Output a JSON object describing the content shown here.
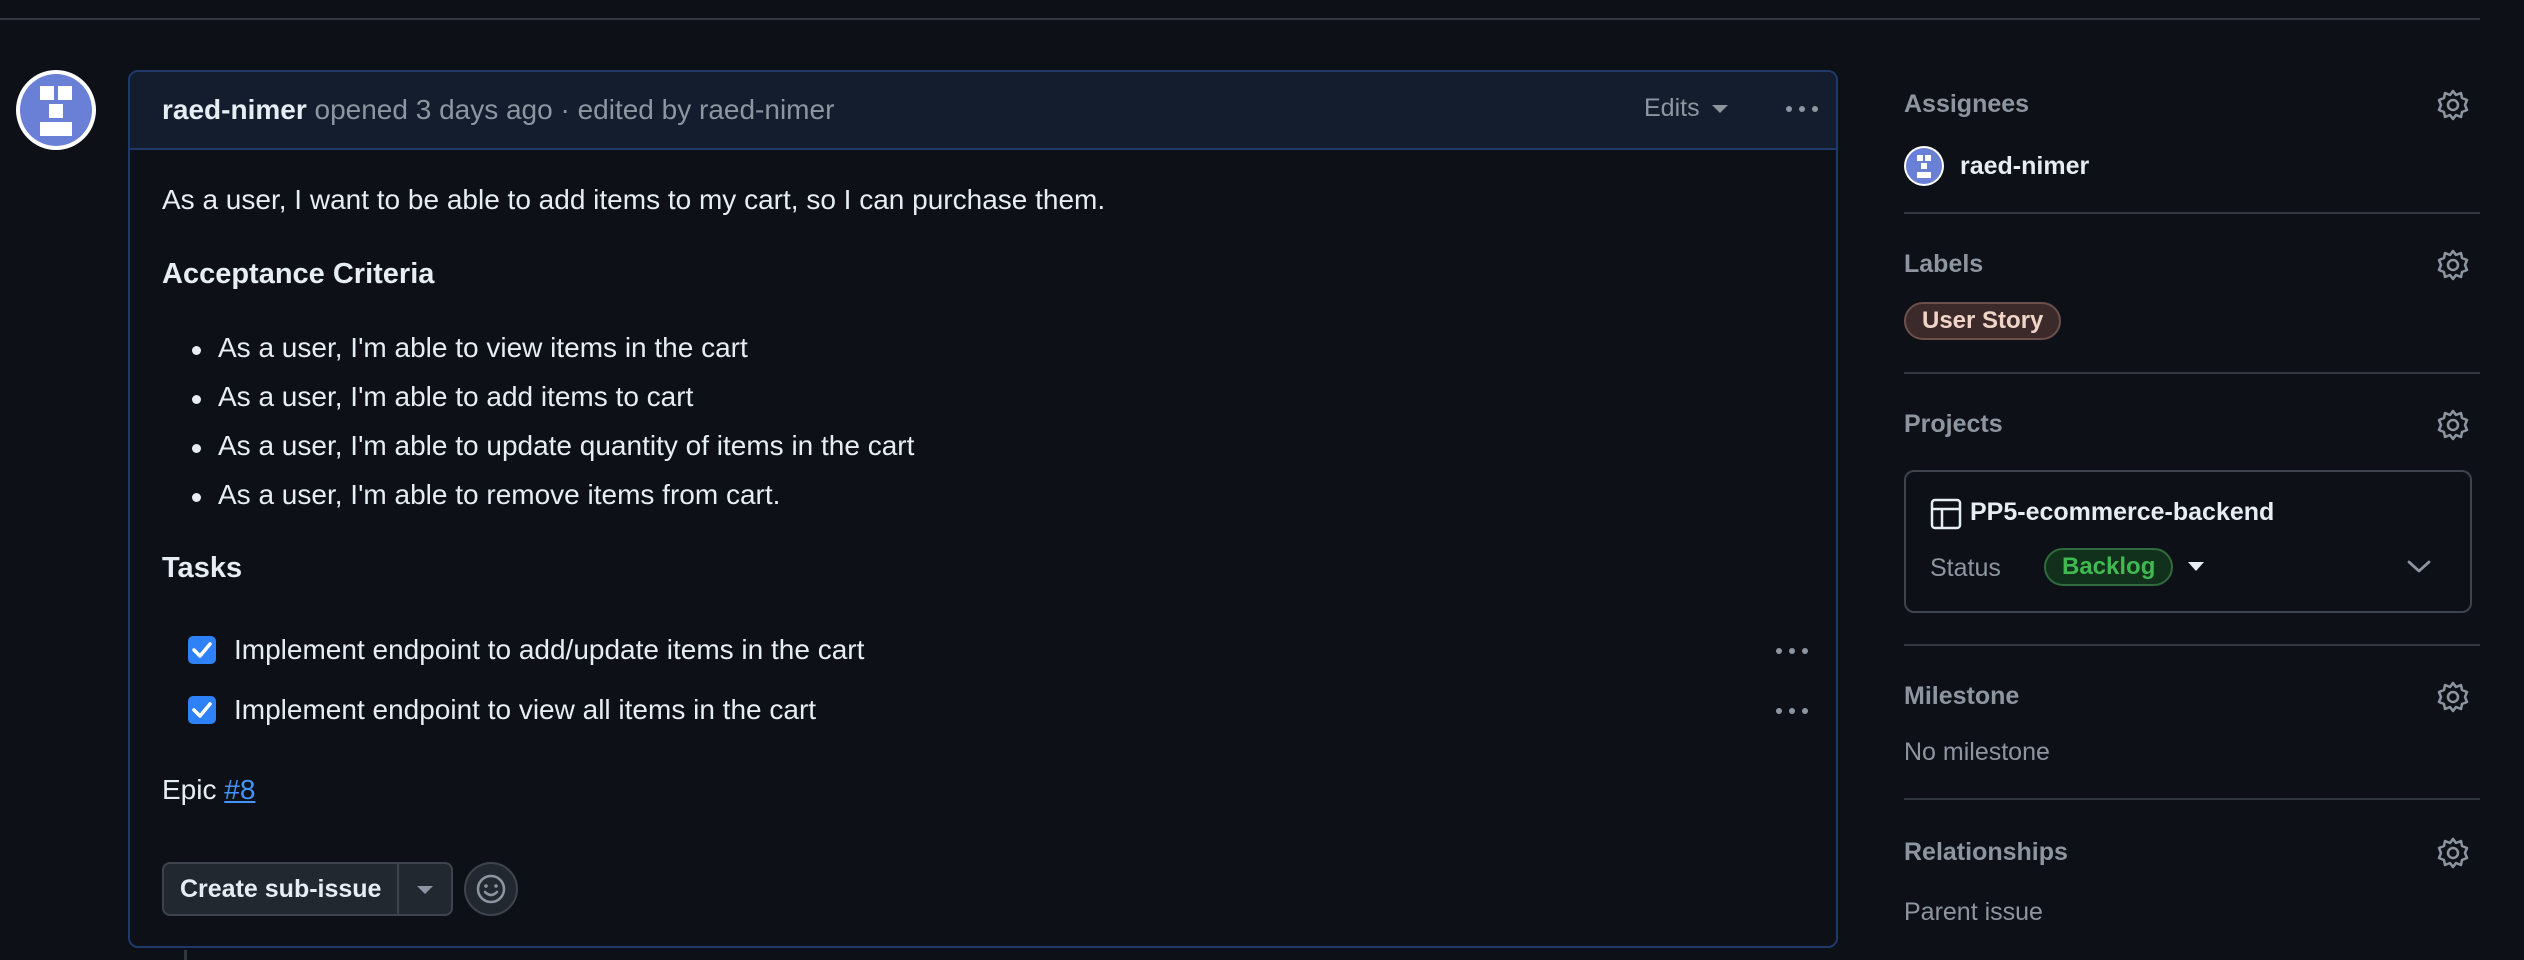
{
  "issue": {
    "author": "raed-nimer",
    "meta": "opened 3 days ago · edited by raed-nimer",
    "edits_label": "Edits",
    "intro": "As a user, I want to be able to add items to my cart, so I can purchase them.",
    "acceptance_heading": "Acceptance Criteria",
    "criteria": [
      "As a user, I'm able to view items in the cart",
      "As a user, I'm able to add items to cart",
      "As a user, I'm able to update quantity of items in the cart",
      "As a user, I'm able to remove items from cart."
    ],
    "tasks_heading": "Tasks",
    "tasks": [
      {
        "label": "Implement endpoint to add/update items in the cart",
        "checked": true
      },
      {
        "label": "Implement endpoint to view all items in the cart",
        "checked": true
      }
    ],
    "epic_prefix": "Epic",
    "epic_link": "#8",
    "create_subissue_label": "Create sub-issue"
  },
  "sidebar": {
    "assignees_label": "Assignees",
    "assignee_name": "raed-nimer",
    "labels_label": "Labels",
    "label_tag": "User Story",
    "projects_label": "Projects",
    "project_name": "PP5-ecommerce-backend",
    "status_label": "Status",
    "status_value": "Backlog",
    "milestone_label": "Milestone",
    "milestone_value": "No milestone",
    "relationships_label": "Relationships",
    "parent_issue_label": "Parent issue"
  },
  "colors": {
    "background": "#0d1117",
    "accent": "#2f81f7",
    "status_green": "#3fb950",
    "label_bg": "#3c2a2a"
  }
}
